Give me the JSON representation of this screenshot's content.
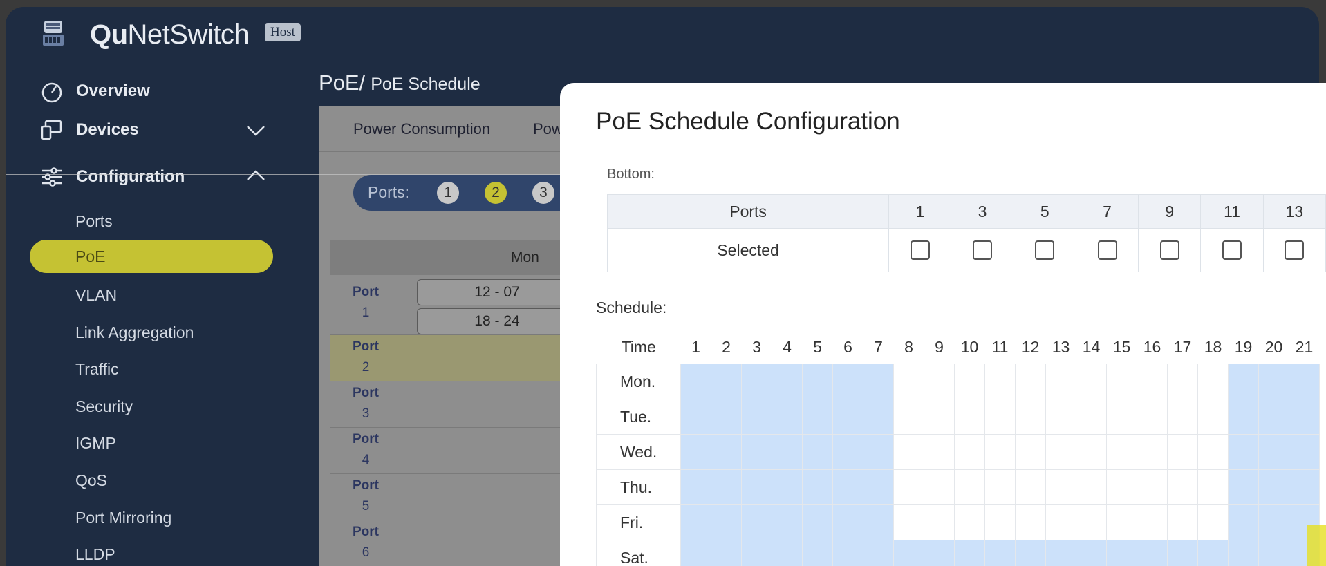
{
  "app": {
    "name_bold": "Qu",
    "name_rest": "NetSwitch",
    "badge": "Host"
  },
  "sidebar": {
    "overview": "Overview",
    "devices": "Devices",
    "configuration": "Configuration",
    "items": [
      "Ports",
      "PoE",
      "VLAN",
      "Link Aggregation",
      "Traffic",
      "Security",
      "IGMP",
      "QoS",
      "Port Mirroring",
      "LLDP"
    ],
    "selected": "PoE"
  },
  "breadcrumb": {
    "section": "PoE/",
    "page": "PoE Schedule"
  },
  "main": {
    "tabs": [
      "Power Consumption",
      "Pow"
    ],
    "ports_label": "Ports:",
    "port_buttons": [
      "1",
      "2",
      "3"
    ],
    "selected_port": "2",
    "day_header": "Mon",
    "rows": [
      {
        "label": "Port",
        "num": "1",
        "times": [
          "12 - 07",
          "18 - 24"
        ]
      },
      {
        "label": "Port",
        "num": "2",
        "times": []
      },
      {
        "label": "Port",
        "num": "3",
        "times": []
      },
      {
        "label": "Port",
        "num": "4",
        "times": []
      },
      {
        "label": "Port",
        "num": "5",
        "times": []
      },
      {
        "label": "Port",
        "num": "6",
        "times": []
      }
    ]
  },
  "dialog": {
    "title": "PoE Schedule Configuration",
    "bottom_label": "Bottom:",
    "ports_header": "Ports",
    "selected_label": "Selected",
    "port_numbers": [
      "1",
      "3",
      "5",
      "7",
      "9",
      "11",
      "13"
    ],
    "schedule_label": "Schedule:",
    "time_label": "Time",
    "hours": [
      "1",
      "2",
      "3",
      "4",
      "5",
      "6",
      "7",
      "8",
      "9",
      "10",
      "11",
      "12",
      "13",
      "14",
      "15",
      "16",
      "17",
      "18",
      "19",
      "20",
      "21"
    ],
    "days": [
      "Mon.",
      "Tue.",
      "Wed.",
      "Thu.",
      "Fri.",
      "Sat."
    ],
    "weekday_active_hours": [
      1,
      2,
      3,
      4,
      5,
      6,
      7,
      19,
      20,
      21
    ],
    "sat_all_active": true
  },
  "colors": {
    "accent": "#c5c233",
    "sidebar_bg": "#1e2c42",
    "schedule_on": "#cce1fa"
  }
}
